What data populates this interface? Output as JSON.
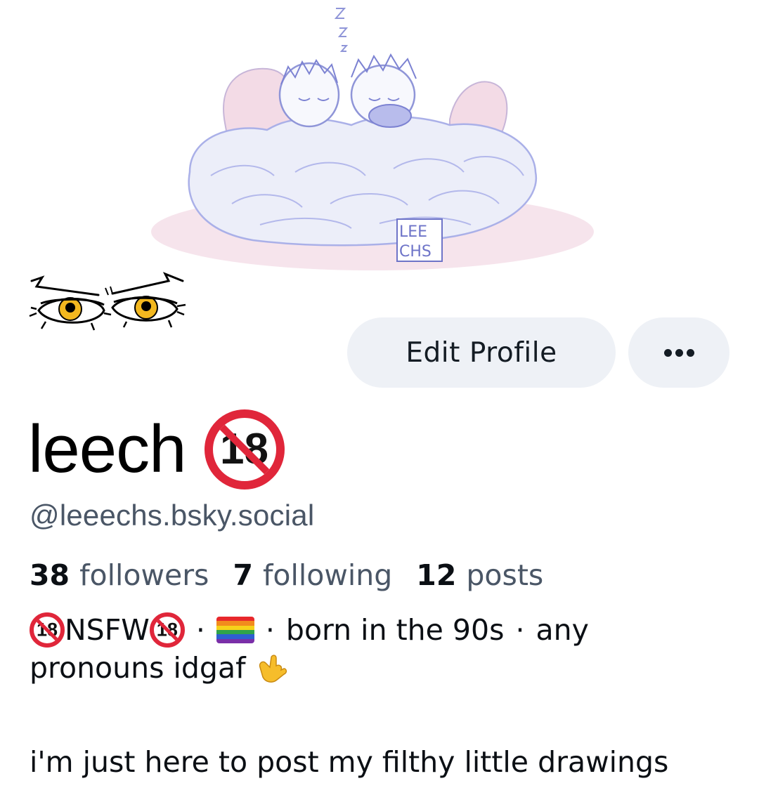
{
  "banner": {
    "signature_text": "LEECHS",
    "signature_line1": "LEE",
    "signature_line2": "CHS",
    "sleep_text": "zzz"
  },
  "profile": {
    "display_name": "leech",
    "name_badge": "18",
    "handle": "@leeechs.bsky.social"
  },
  "actions": {
    "edit_label": "Edit Profile",
    "more_icon": "ellipsis-icon"
  },
  "stats": [
    {
      "count": "38",
      "label": "followers"
    },
    {
      "count": "7",
      "label": "following"
    },
    {
      "count": "12",
      "label": "posts"
    }
  ],
  "bio": {
    "badge": "18",
    "nsfw": "NSFW",
    "separator": "·",
    "flag_icon": "rainbow-flag-icon",
    "born": "born in the 90s",
    "any": "any",
    "pronouns": "pronouns idgaf",
    "hand_icon": "call-me-hand-icon",
    "tagline": "i'm just here to post my filthy little drawings"
  },
  "colors": {
    "button_bg": "#eef1f6",
    "secondary_text": "#4a5666",
    "badge_red": "#e0263a",
    "banner_lavender": "#aab0e8",
    "banner_pink": "#f4dde6"
  }
}
